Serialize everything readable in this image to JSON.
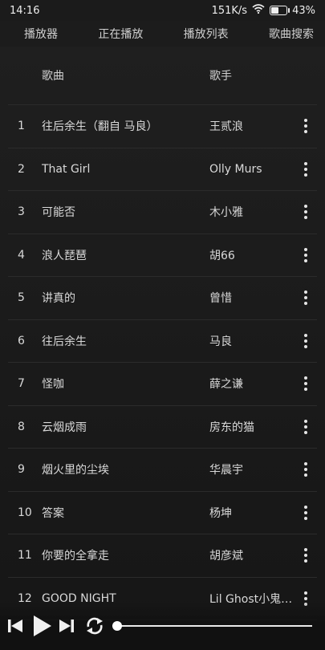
{
  "status": {
    "time": "14:16",
    "speed": "151K/s",
    "battery": "43%"
  },
  "tabs": [
    "播放器",
    "正在播放",
    "播放列表",
    "歌曲搜索"
  ],
  "header": {
    "title_col": "歌曲",
    "artist_col": "歌手"
  },
  "songs": [
    {
      "num": "1",
      "title": "往后余生（翻自 马良）",
      "artist": "王贰浪"
    },
    {
      "num": "2",
      "title": "That Girl",
      "artist": "Olly Murs"
    },
    {
      "num": "3",
      "title": "可能否",
      "artist": "木小雅"
    },
    {
      "num": "4",
      "title": "浪人琵琶",
      "artist": "胡66"
    },
    {
      "num": "5",
      "title": "讲真的",
      "artist": "曾惜"
    },
    {
      "num": "6",
      "title": "往后余生",
      "artist": "马良"
    },
    {
      "num": "7",
      "title": "怪咖",
      "artist": "薛之谦"
    },
    {
      "num": "8",
      "title": "云烟成雨",
      "artist": "房东的猫"
    },
    {
      "num": "9",
      "title": "烟火里的尘埃",
      "artist": "华晨宇"
    },
    {
      "num": "10",
      "title": "答案",
      "artist": "杨坤"
    },
    {
      "num": "11",
      "title": "你要的全拿走",
      "artist": "胡彦斌"
    },
    {
      "num": "12",
      "title": "GOOD NIGHT",
      "artist": "Lil Ghost小鬼-..."
    }
  ],
  "player": {
    "progress": 0.0
  }
}
